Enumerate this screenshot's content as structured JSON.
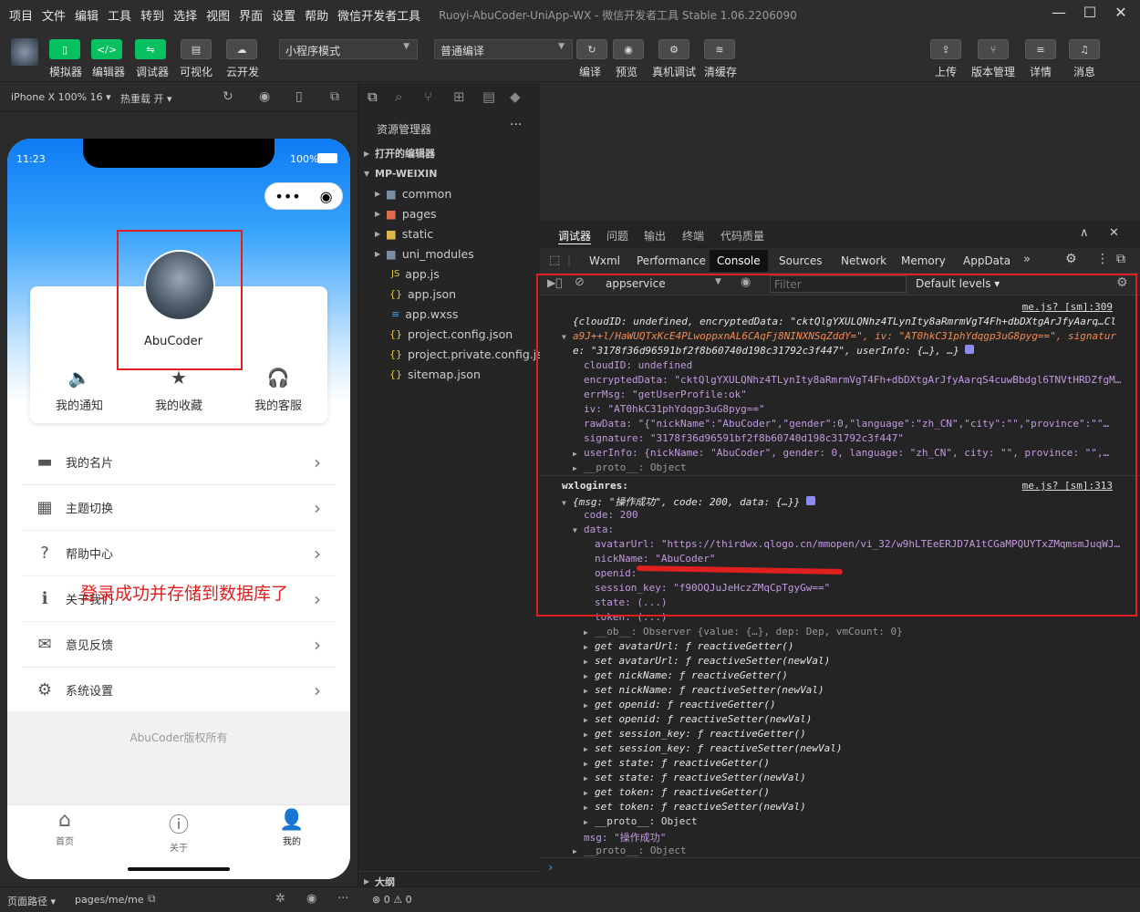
{
  "menubar": {
    "items": [
      "项目",
      "文件",
      "编辑",
      "工具",
      "转到",
      "选择",
      "视图",
      "界面",
      "设置",
      "帮助",
      "微信开发者工具"
    ],
    "window_title": "Ruoyi-AbuCoder-UniApp-WX - 微信开发者工具 Stable 1.06.2206090"
  },
  "toolbar": {
    "left_labels": [
      "模拟器",
      "编辑器",
      "调试器",
      "可视化",
      "云开发"
    ],
    "mode_select": "小程序模式",
    "compile_select": "普通编译",
    "mid_labels": [
      "编译",
      "预览",
      "真机调试",
      "清缓存"
    ],
    "right_labels": [
      "上传",
      "版本管理",
      "详情",
      "消息"
    ]
  },
  "simbar": {
    "device": "iPhone X 100% 16 ▾",
    "hotreload": "热重载 开 ▾"
  },
  "phone": {
    "time": "11:23",
    "battery": "100%",
    "nickname": "AbuCoder",
    "card_menu": [
      "我的通知",
      "我的收藏",
      "我的客服"
    ],
    "rows": [
      "我的名片",
      "主题切换",
      "帮助中心",
      "关于我们",
      "意见反馈",
      "系统设置"
    ],
    "overlay_text": "登录成功并存储到数据库了",
    "copyright": "AbuCoder版权所有",
    "tabs": [
      "首页",
      "关于",
      "我的"
    ]
  },
  "bottom": {
    "path_label": "页面路径 ▾",
    "path": "pages/me/me",
    "errors": "⊗ 0 ⚠ 0"
  },
  "explorer": {
    "title": "资源管理器",
    "open_editors": "打开的编辑器",
    "project": "MP-WEIXIN",
    "folders": [
      "common",
      "pages",
      "static",
      "uni_modules"
    ],
    "files": [
      "app.js",
      "app.json",
      "app.wxss",
      "project.config.json",
      "project.private.config.js...",
      "sitemap.json"
    ],
    "outline": "大纲"
  },
  "devtools": {
    "top_tabs": [
      "调试器",
      "问题",
      "输出",
      "终端",
      "代码质量"
    ],
    "panel_tabs": [
      "Wxml",
      "Performance",
      "Console",
      "Sources",
      "Network",
      "Memory",
      "AppData"
    ],
    "context": "appservice",
    "filter_placeholder": "Filter",
    "levels": "Default levels ▾",
    "link1": "me.js? [sm]:309",
    "link2": "me.js? [sm]:313"
  },
  "console": {
    "l1": "{cloudID: undefined, encryptedData: \"cktQlgYXULQNhz4TLynIty8aRmrmVgT4Fh+dbDXtgArJfyAarq…Cl",
    "l2": "a9J++l/HaWUQTxKcE4PLwoppxnAL6CAqFj8NINXNSqZddY=\", iv: \"AT0hkC31phYdqgp3uG8pyg==\", signatur",
    "l3": "e: \"3178f36d96591bf2f8b60740d198c31792c3f447\", userInfo: {…}, …}",
    "cloudID": "cloudID: undefined",
    "encryptedData": "encryptedData: \"cktQlgYXULQNhz4TLynIty8aRmrmVgT4Fh+dbDXtgArJfyAarqS4cuwBbdgl6TNVtHRDZfgM…",
    "errMsg": "errMsg: \"getUserProfile:ok\"",
    "iv": "iv: \"AT0hkC31phYdqgp3uG8pyg==\"",
    "rawData": "rawData: \"{\"nickName\":\"AbuCoder\",\"gender\":0,\"language\":\"zh_CN\",\"city\":\"\",\"province\":\"\"…",
    "signature": "signature: \"3178f36d96591bf2f8b60740d198c31792c3f447\"",
    "userInfo": "userInfo: {nickName: \"AbuCoder\", gender: 0, language: \"zh_CN\", city: \"\", province: \"\",…",
    "proto1": "__proto__: Object",
    "wxloginres": "wxloginres:",
    "msgobj": "{msg: \"操作成功\", code: 200, data: {…}}",
    "code": "code: 200",
    "data": "data:",
    "avatarUrl": "avatarUrl: \"https://thirdwx.qlogo.cn/mmopen/vi_32/w9hLTEeERJD7A1tCGaMPQUYTxZMqmsmJuqWJ…",
    "nickName": "nickName: \"AbuCoder\"",
    "openid": "openid: ",
    "session_key": "session_key: \"f90OQJuJeHczZMqCpTgyGw==\"",
    "state": "state: (...)",
    "token": "token: (...)",
    "ob": "__ob__: Observer {value: {…}, dep: Dep, vmCount: 0}",
    "getters": [
      "get avatarUrl: ƒ reactiveGetter()",
      "set avatarUrl: ƒ reactiveSetter(newVal)",
      "get nickName: ƒ reactiveGetter()",
      "set nickName: ƒ reactiveSetter(newVal)",
      "get openid: ƒ reactiveGetter()",
      "set openid: ƒ reactiveSetter(newVal)",
      "get session_key: ƒ reactiveGetter()",
      "set session_key: ƒ reactiveSetter(newVal)",
      "get state: ƒ reactiveGetter()",
      "set state: ƒ reactiveSetter(newVal)",
      "get token: ƒ reactiveGetter()",
      "set token: ƒ reactiveSetter(newVal)",
      "__proto__: Object"
    ],
    "msg": "msg: \"操作成功\"",
    "proto2": "__proto__: Object"
  },
  "colors": {
    "accent_green": "#07c160",
    "highlight_red": "#e02020",
    "phone_blue": "#0e7bf5"
  }
}
